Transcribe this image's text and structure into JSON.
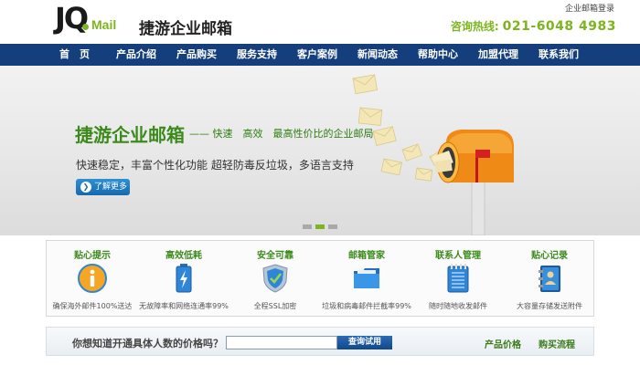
{
  "header": {
    "logo_jq": "JQ",
    "logo_mail": "Mail",
    "brand": "捷游企业邮箱",
    "login_link": "企业邮箱登录",
    "hotline_label": "咨询热线:",
    "hotline_number": "021-6048 4983"
  },
  "nav": {
    "items": [
      {
        "label": "首　页"
      },
      {
        "label": "产品介绍"
      },
      {
        "label": "产品购买"
      },
      {
        "label": "服务支持"
      },
      {
        "label": "客户案例"
      },
      {
        "label": "新闻动态"
      },
      {
        "label": "帮助中心"
      },
      {
        "label": "加盟代理"
      },
      {
        "label": "联系我们"
      }
    ]
  },
  "banner": {
    "title": "捷游企业邮箱",
    "slogan": "—— 快速　高效　最高性价比的企业邮局",
    "description": "快速稳定，丰富个性化功能  超轻防毒反垃圾，多语言支持",
    "more_button": "了解更多",
    "slide_count": 3,
    "active_slide": 2
  },
  "features": [
    {
      "title": "贴心提示",
      "desc": "确保海外邮件100%送达",
      "icon": "info-icon"
    },
    {
      "title": "高效低耗",
      "desc": "无故障率和网络连通率99%",
      "icon": "battery-icon"
    },
    {
      "title": "安全可靠",
      "desc": "全程SSL加密",
      "icon": "shield-icon"
    },
    {
      "title": "邮箱管家",
      "desc": "垃圾和病毒邮件拦截率99%",
      "icon": "folder-icon"
    },
    {
      "title": "联系人管理",
      "desc": "随时随地收发邮件",
      "icon": "notepad-icon"
    },
    {
      "title": "贴心记录",
      "desc": "大容量存储发送附件",
      "icon": "contact-book-icon"
    }
  ],
  "query": {
    "label": "你想知道开通具体人数的价格吗？",
    "input_value": "",
    "button": "查询试用",
    "link_price": "产品价格",
    "link_process": "购买流程"
  },
  "colors": {
    "brand_green": "#7cb51d",
    "nav_blue": "#153f7c",
    "title_green": "#3b8a1b"
  }
}
